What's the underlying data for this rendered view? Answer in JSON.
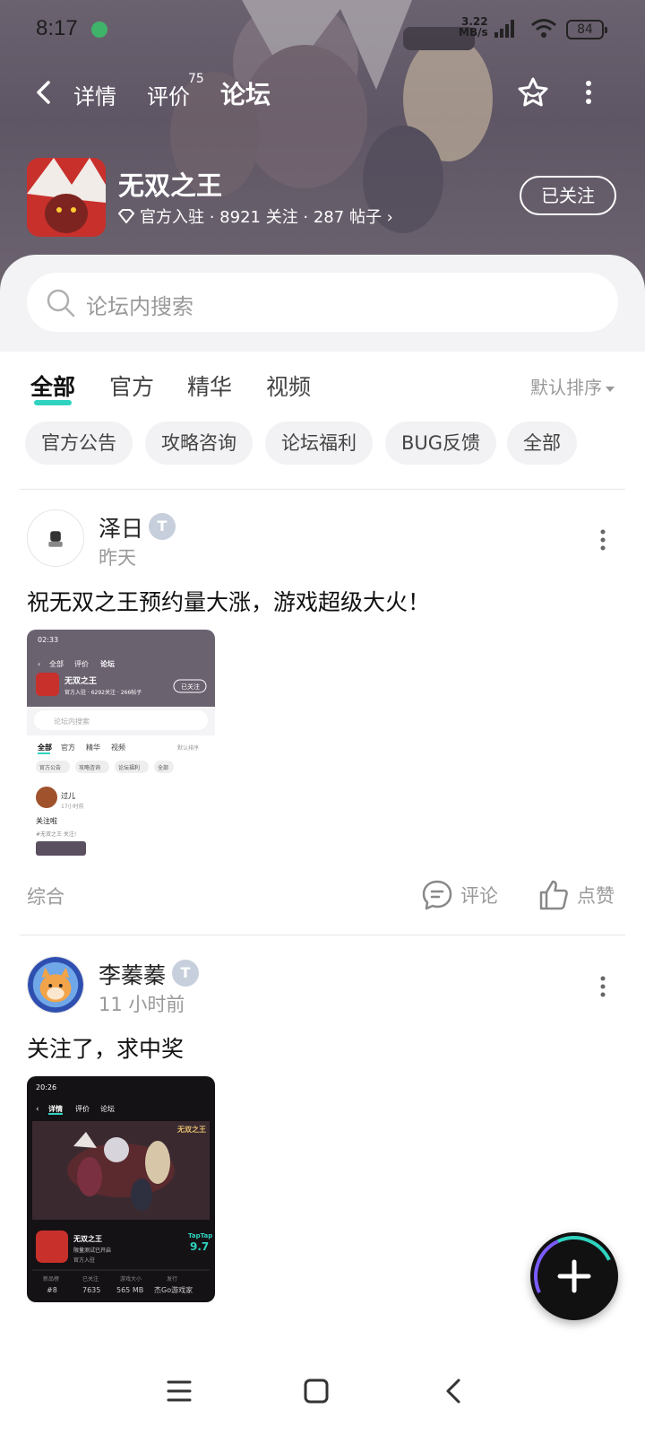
{
  "status_bar": {
    "time": "8:17",
    "net_speed": "3.22",
    "net_unit": "MB/s",
    "battery": "84"
  },
  "nav": {
    "tabs": [
      {
        "label": "详情"
      },
      {
        "label": "评价",
        "badge": "75"
      },
      {
        "label": "论坛"
      }
    ]
  },
  "game": {
    "title": "无双之王",
    "meta": "官方入驻 · 8921 关注 · 287 帖子 ›",
    "follow_label": "已关注"
  },
  "search": {
    "placeholder": "论坛内搜索"
  },
  "filter_tabs": {
    "items": [
      "全部",
      "官方",
      "精华",
      "视频"
    ],
    "sort_label": "默认排序"
  },
  "chips": [
    "官方公告",
    "攻略咨询",
    "论坛福利",
    "BUG反馈",
    "全部"
  ],
  "posts": [
    {
      "author": "泽日",
      "badge": "T",
      "time": "昨天",
      "text": "祝无双之王预约量大涨，游戏超级大火！",
      "category": "综合",
      "comment_label": "评论",
      "like_label": "点赞"
    },
    {
      "author": "李蓁蓁",
      "badge": "T",
      "time": "11 小时前",
      "text": "关注了，求中奖"
    }
  ],
  "thumb1": {
    "title": "无双之王",
    "meta": "官方入驻 · 6292关注 · 266帖子",
    "follow": "已关注",
    "search": "论坛内搜索",
    "tabs": [
      "全部",
      "官方",
      "精华",
      "视频"
    ],
    "sort": "默认排序",
    "chips": [
      "官方公告",
      "攻略咨询",
      "论坛福利",
      "全部"
    ],
    "user": "过儿",
    "time": "17小时前",
    "text": "关注啦",
    "tag": "#无双之王 关注!"
  },
  "thumb2": {
    "time": "20:26",
    "tabs": [
      "详情",
      "评价",
      "论坛"
    ],
    "logo": "无双之王",
    "title": "无双之王",
    "subtitle": "限量测试已开启",
    "badge": "官方入驻",
    "score_brand": "TapTap",
    "score": "9.7",
    "stats": [
      {
        "k": "新品榜",
        "v": "#8"
      },
      {
        "k": "已关注",
        "v": "7635"
      },
      {
        "k": "游戏大小",
        "v": "565 MB"
      },
      {
        "k": "发行",
        "v": "杰Go游戏家"
      }
    ]
  },
  "colors": {
    "accent": "#2fd3c0",
    "header_bg": "#6b6270"
  }
}
